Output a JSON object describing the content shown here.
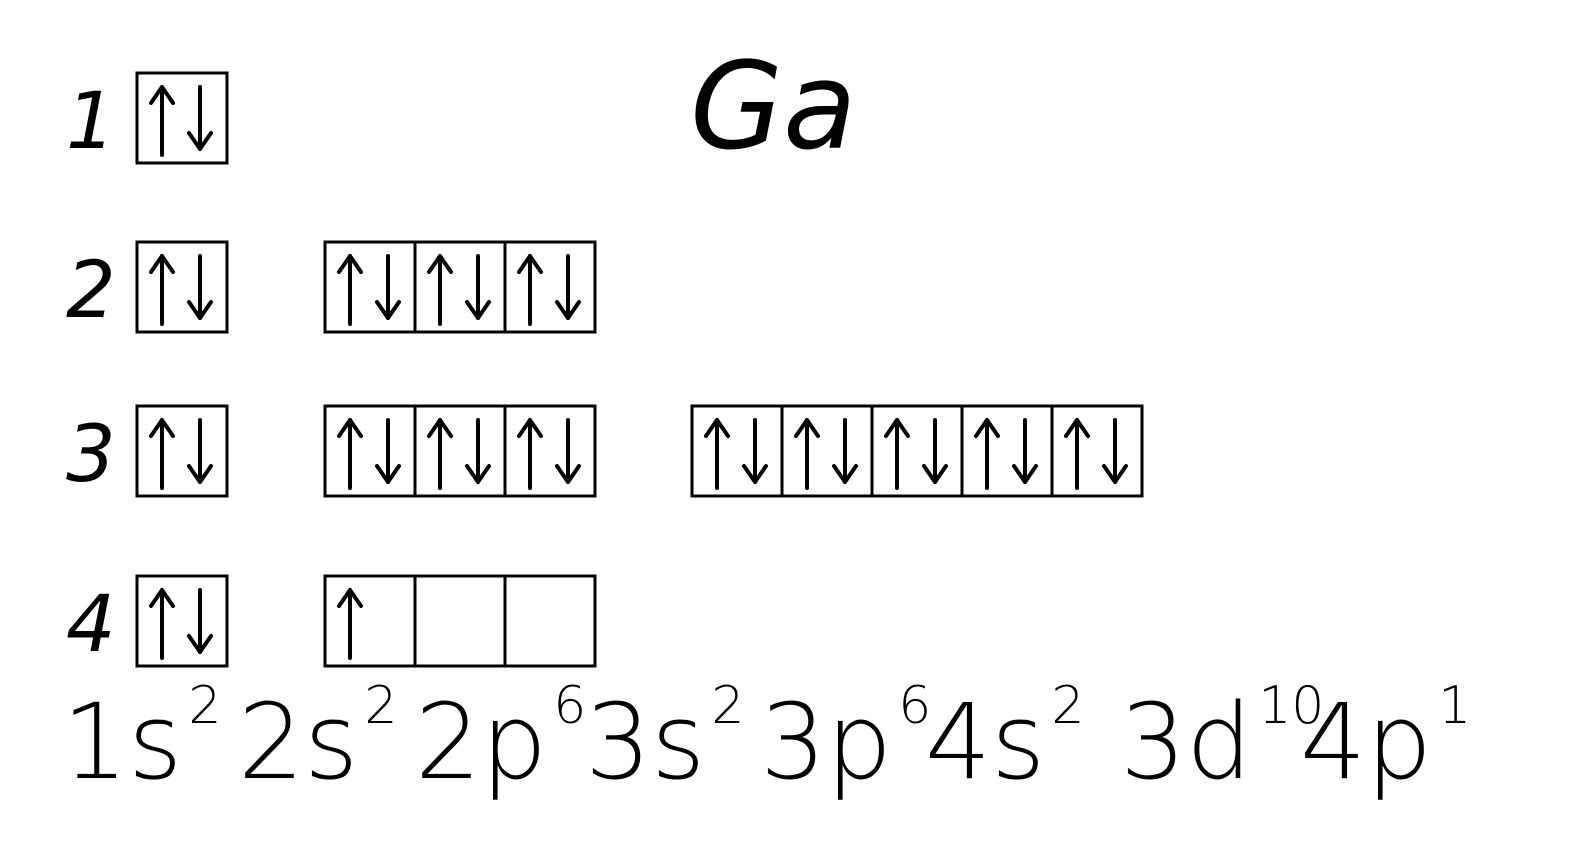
{
  "element": "Ga",
  "rows": [
    {
      "label": "1",
      "subshells": [
        [
          "ud"
        ]
      ]
    },
    {
      "label": "2",
      "subshells": [
        [
          "ud"
        ],
        [
          "ud",
          "ud",
          "ud"
        ]
      ]
    },
    {
      "label": "3",
      "subshells": [
        [
          "ud"
        ],
        [
          "ud",
          "ud",
          "ud"
        ],
        [
          "ud",
          "ud",
          "ud",
          "ud",
          "ud"
        ]
      ]
    },
    {
      "label": "4",
      "subshells": [
        [
          "ud"
        ],
        [
          "u",
          "",
          ""
        ]
      ]
    }
  ],
  "configuration": [
    {
      "base": "1s",
      "sup": "2"
    },
    {
      "base": "2s",
      "sup": "2"
    },
    {
      "base": "2p",
      "sup": "6"
    },
    {
      "base": "3s",
      "sup": "2"
    },
    {
      "base": "3p",
      "sup": "6"
    },
    {
      "base": "4s",
      "sup": "2"
    },
    {
      "base": "3d",
      "sup": "10"
    },
    {
      "base": "4p",
      "sup": "1"
    }
  ],
  "colors": {
    "ink": "#000000",
    "background": "#ffffff"
  }
}
